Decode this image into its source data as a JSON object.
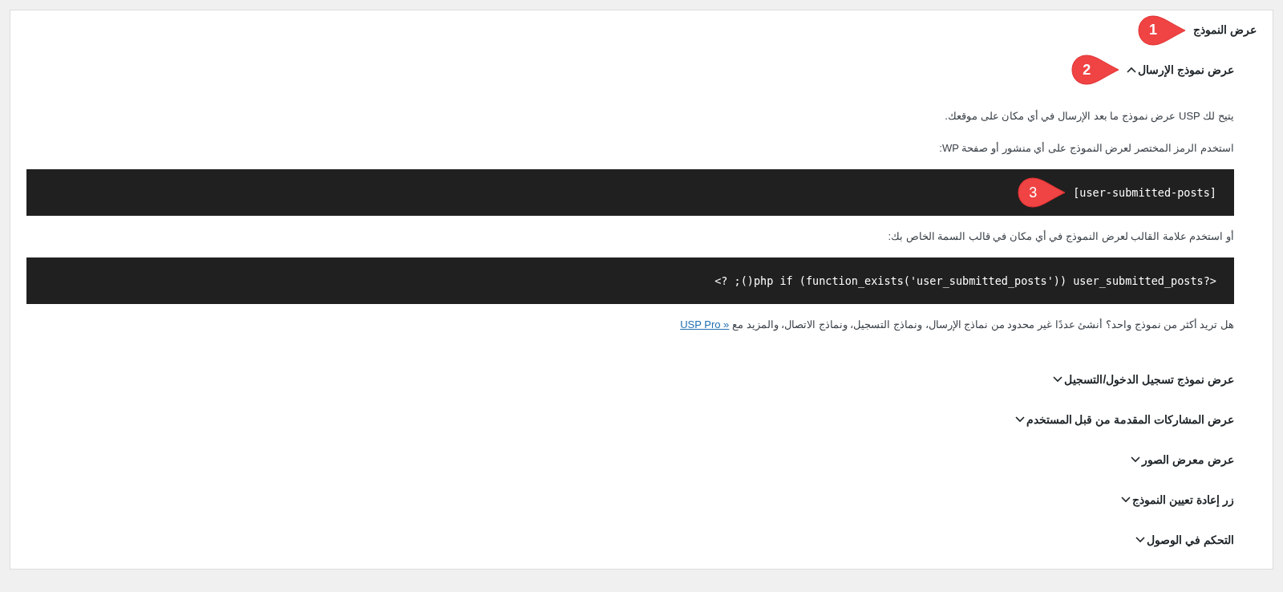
{
  "title": {
    "text": "عرض النموذج",
    "callout": "1"
  },
  "sections": [
    {
      "heading": "عرض نموذج الإرسال",
      "expanded": true,
      "callout": "2",
      "body": [
        {
          "kind": "paragraph",
          "text": "يتيح لك USP عرض نموذج ما بعد الإرسال في أي مكان على موقعك."
        },
        {
          "kind": "paragraph",
          "text": "استخدم الرمز المختصر لعرض النموذج على أي منشور أو صفحة WP:"
        },
        {
          "kind": "code",
          "text": "[user-submitted-posts]",
          "callout": "3"
        },
        {
          "kind": "paragraph",
          "text": "أو استخدم علامة القالب لعرض النموذج في أي مكان في قالب السمة الخاص بك:"
        },
        {
          "kind": "code",
          "text": "<? ;()php if (function_exists('user_submitted_posts')) user_submitted_posts?>"
        },
        {
          "kind": "paragraph",
          "text": "هل تريد أكثر من نموذج واحد؟ أنشئ عددًا غير محدود من نماذج الإرسال، ونماذج التسجيل، ونماذج الاتصال، والمزيد مع",
          "link": "USP Pro »"
        }
      ]
    },
    {
      "heading": "عرض نموذج تسجيل الدخول/التسجيل",
      "expanded": false
    },
    {
      "heading": "عرض المشاركات المقدمة من قبل المستخدم",
      "expanded": false
    },
    {
      "heading": "عرض معرض الصور",
      "expanded": false
    },
    {
      "heading": "زر إعادة تعيين النموذج",
      "expanded": false
    },
    {
      "heading": "التحكم في الوصول",
      "expanded": false
    }
  ]
}
